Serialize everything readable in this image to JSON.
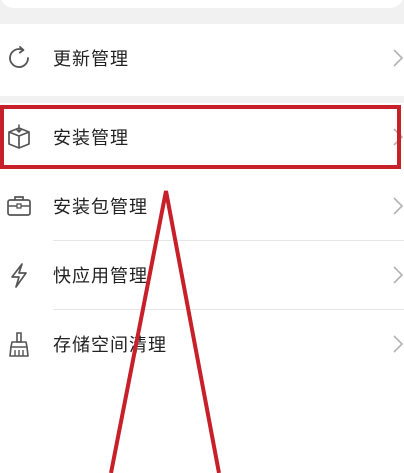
{
  "menu": {
    "items": [
      {
        "label": "更新管理",
        "icon": "refresh-icon"
      },
      {
        "label": "安装管理",
        "icon": "box-icon"
      },
      {
        "label": "安装包管理",
        "icon": "briefcase-icon"
      },
      {
        "label": "快应用管理",
        "icon": "lightning-icon"
      },
      {
        "label": "存储空间清理",
        "icon": "broom-icon"
      }
    ]
  },
  "colors": {
    "background": "#f1f1f1",
    "card": "#ffffff",
    "text": "#222222",
    "icon": "#555555",
    "chevron": "#b3b3b3",
    "annotation": "#c8202a"
  }
}
